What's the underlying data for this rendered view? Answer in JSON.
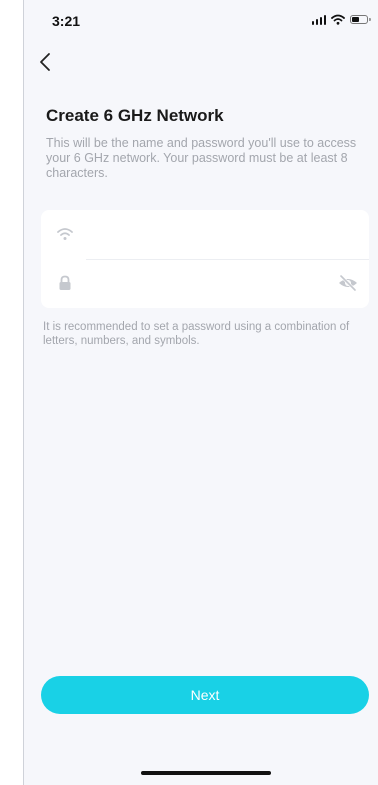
{
  "status_bar": {
    "time": "3:21"
  },
  "header": {
    "back_icon": "chevron-left-icon",
    "title": "Create 6 GHz Network",
    "description": "This will be the name and password you'll use to access your 6 GHz network. Your password must be at least 8 characters."
  },
  "form": {
    "network_name": {
      "icon": "wifi-icon",
      "value": "",
      "placeholder": ""
    },
    "password": {
      "icon": "lock-icon",
      "value": "",
      "placeholder": "",
      "visibility_icon": "eye-off-icon"
    },
    "hint": "It is recommended to set a password using a combination of letters, numbers, and symbols."
  },
  "actions": {
    "next_label": "Next"
  },
  "colors": {
    "accent": "#19d1e6",
    "background": "#f6f7fb",
    "muted_text": "#a3a6ad",
    "icon_gray": "#c5c8ce"
  }
}
